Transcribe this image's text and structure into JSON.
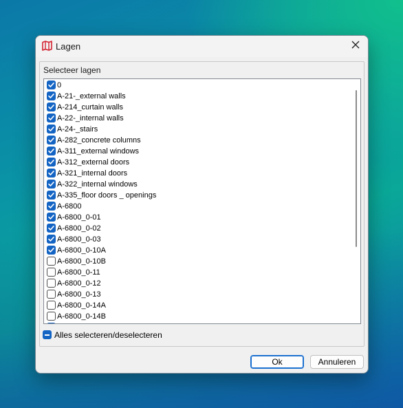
{
  "window": {
    "title": "Lagen",
    "title_icon": "map-icon",
    "close_icon": "close-icon"
  },
  "group": {
    "label": "Selecteer lagen"
  },
  "layers": [
    {
      "label": "0",
      "checked": true
    },
    {
      "label": "A-21-_external walls",
      "checked": true
    },
    {
      "label": "A-214_curtain walls",
      "checked": true
    },
    {
      "label": "A-22-_internal walls",
      "checked": true
    },
    {
      "label": "A-24-_stairs",
      "checked": true
    },
    {
      "label": "A-282_concrete columns",
      "checked": true
    },
    {
      "label": "A-311_external windows",
      "checked": true
    },
    {
      "label": "A-312_external doors",
      "checked": true
    },
    {
      "label": "A-321_internal doors",
      "checked": true
    },
    {
      "label": "A-322_internal windows",
      "checked": true
    },
    {
      "label": "A-335_floor doors _ openings",
      "checked": true
    },
    {
      "label": "A-6800",
      "checked": true
    },
    {
      "label": "A-6800_0-01",
      "checked": true
    },
    {
      "label": "A-6800_0-02",
      "checked": true
    },
    {
      "label": "A-6800_0-03",
      "checked": true
    },
    {
      "label": "A-6800_0-10A",
      "checked": true
    },
    {
      "label": "A-6800_0-10B",
      "checked": false
    },
    {
      "label": "A-6800_0-11",
      "checked": false
    },
    {
      "label": "A-6800_0-12",
      "checked": false
    },
    {
      "label": "A-6800_0-13",
      "checked": false
    },
    {
      "label": "A-6800_0-14A",
      "checked": false
    },
    {
      "label": "A-6800_0-14B",
      "checked": false
    },
    {
      "label": "",
      "checked": true
    }
  ],
  "select_all": {
    "label": "Alles selecteren/deselecteren",
    "state": "indeterminate"
  },
  "buttons": {
    "ok_label": "Ok",
    "cancel_label": "Annuleren"
  },
  "colors": {
    "accent": "#1464c4",
    "dialog_bg": "#f0f0f0"
  }
}
